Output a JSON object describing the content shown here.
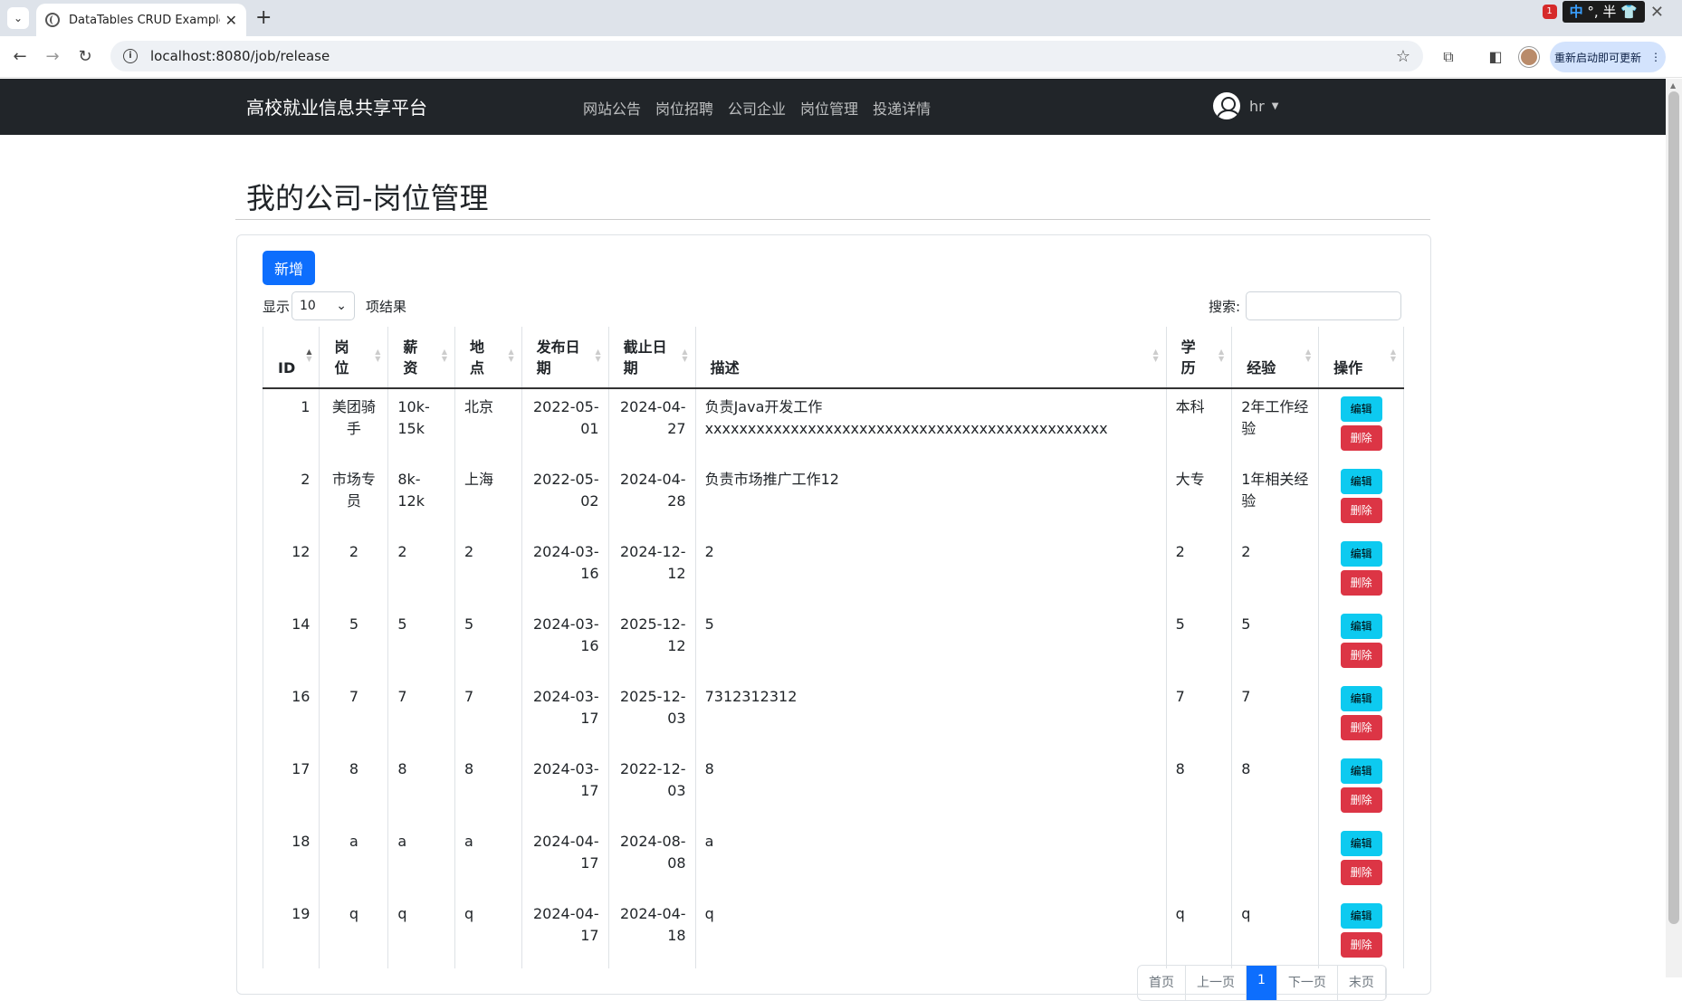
{
  "browser": {
    "tab_title": "DataTables CRUD Example w",
    "url": "localhost:8080/job/release",
    "update_label": "重新启动即可更新",
    "tray_badge": "1",
    "ime_label": "中",
    "ime_extra": "°, 半"
  },
  "navbar": {
    "brand": "高校就业信息共享平台",
    "links": [
      "网站公告",
      "岗位招聘",
      "公司企业",
      "岗位管理",
      "投递详情"
    ],
    "user": "hr"
  },
  "page": {
    "title": "我的公司-岗位管理",
    "add_label": "新增",
    "length_prefix": "显示",
    "length_value": "10",
    "length_suffix": "项结果",
    "search_label": "搜索:"
  },
  "table": {
    "headers": [
      {
        "label": "ID"
      },
      {
        "label": "岗\n位"
      },
      {
        "label": "薪\n资"
      },
      {
        "label": "地\n点"
      },
      {
        "label": "发布日\n期"
      },
      {
        "label": "截止日\n期"
      },
      {
        "label": "描述"
      },
      {
        "label": "学\n历"
      },
      {
        "label": "经验"
      },
      {
        "label": "操作"
      }
    ],
    "edit_label": "编辑",
    "delete_label": "删除",
    "rows": [
      {
        "id": "1",
        "job": "美团骑\n手",
        "salary": "10k-\n15k",
        "place": "北京",
        "pub": "2022-05-\n01",
        "end": "2024-04-\n27",
        "desc": "负责Java开发工作\nxxxxxxxxxxxxxxxxxxxxxxxxxxxxxxxxxxxxxxxxxxxxxxx",
        "edu": "本科",
        "exp": "2年工作经\n验"
      },
      {
        "id": "2",
        "job": "市场专\n员",
        "salary": "8k-12k",
        "place": "上海",
        "pub": "2022-05-\n02",
        "end": "2024-04-\n28",
        "desc": "负责市场推广工作12",
        "edu": "大专",
        "exp": "1年相关经\n验"
      },
      {
        "id": "12",
        "job": "2",
        "salary": "2",
        "place": "2",
        "pub": "2024-03-\n16",
        "end": "2024-12-\n12",
        "desc": "2",
        "edu": "2",
        "exp": "2"
      },
      {
        "id": "14",
        "job": "5",
        "salary": "5",
        "place": "5",
        "pub": "2024-03-\n16",
        "end": "2025-12-\n12",
        "desc": "5",
        "edu": "5",
        "exp": "5"
      },
      {
        "id": "16",
        "job": "7",
        "salary": "7",
        "place": "7",
        "pub": "2024-03-\n17",
        "end": "2025-12-\n03",
        "desc": "7312312312",
        "edu": "7",
        "exp": "7"
      },
      {
        "id": "17",
        "job": "8",
        "salary": "8",
        "place": "8",
        "pub": "2024-03-\n17",
        "end": "2022-12-\n03",
        "desc": "8",
        "edu": "8",
        "exp": "8"
      },
      {
        "id": "18",
        "job": "a",
        "salary": "a",
        "place": "a",
        "pub": "2024-04-\n17",
        "end": "2024-08-\n08",
        "desc": "a",
        "edu": "",
        "exp": ""
      },
      {
        "id": "19",
        "job": "q",
        "salary": "q",
        "place": "q",
        "pub": "2024-04-\n17",
        "end": "2024-04-\n18",
        "desc": "q",
        "edu": "q",
        "exp": "q"
      }
    ]
  },
  "pagination": {
    "items": [
      "首页",
      "上一页",
      "1",
      "下一页",
      "末页"
    ],
    "active_index": 2
  }
}
